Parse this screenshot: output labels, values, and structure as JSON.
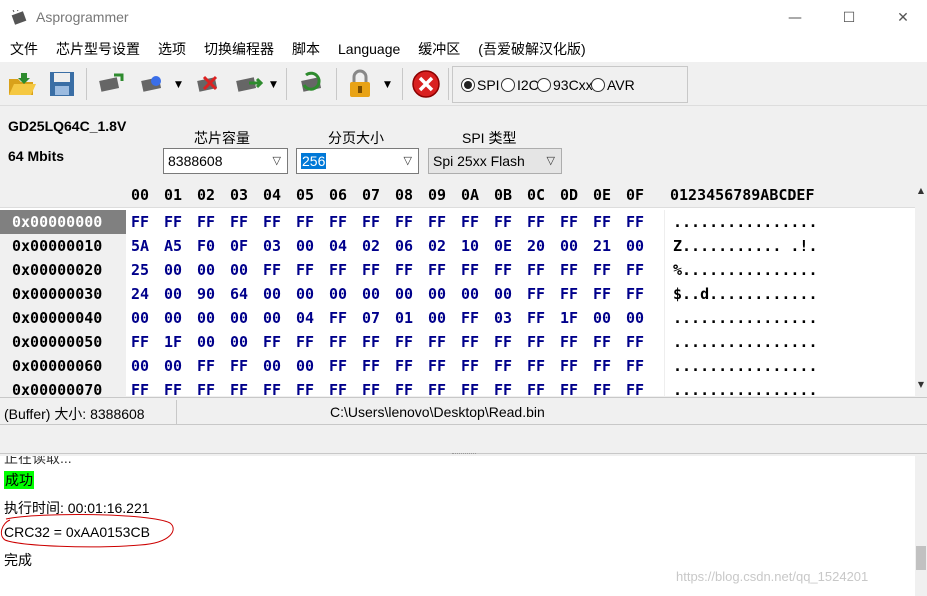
{
  "window": {
    "title": "Asprogrammer",
    "min_glyph": "—",
    "max_glyph": "☐",
    "close_glyph": "✕"
  },
  "menu": [
    "文件",
    "芯片型号设置",
    "选项",
    "切换编程器",
    "脚本",
    "Language",
    "缓冲区",
    "(吾爱破解汉化版)"
  ],
  "toolbar": {
    "icons": [
      "open-folder-icon",
      "save-icon",
      "read-chip-icon",
      "write-chip-icon",
      "erase-chip-icon",
      "verify-chip-icon",
      "auto-program-icon",
      "lock-icon",
      "stop-icon"
    ],
    "radios": [
      {
        "label": "SPI",
        "checked": true
      },
      {
        "label": "I2C",
        "checked": false
      },
      {
        "label": "93Cxx",
        "checked": false
      },
      {
        "label": "AVR",
        "checked": false
      }
    ]
  },
  "chip": {
    "name": "GD25LQ64C_1.8V",
    "size": "64 Mbits",
    "capacity_label": "芯片容量",
    "capacity_value": "8388608",
    "page_label": "分页大小",
    "page_value": "256",
    "spi_label": "SPI 类型",
    "spi_value": "Spi 25xx Flash"
  },
  "hex": {
    "columns": [
      "00",
      "01",
      "02",
      "03",
      "04",
      "05",
      "06",
      "07",
      "08",
      "09",
      "0A",
      "0B",
      "0C",
      "0D",
      "0E",
      "0F"
    ],
    "ascii_header": "0123456789ABCDEF",
    "rows": [
      {
        "addr": "0x00000000",
        "bytes": [
          "FF",
          "FF",
          "FF",
          "FF",
          "FF",
          "FF",
          "FF",
          "FF",
          "FF",
          "FF",
          "FF",
          "FF",
          "FF",
          "FF",
          "FF",
          "FF"
        ],
        "ascii": "................"
      },
      {
        "addr": "0x00000010",
        "bytes": [
          "5A",
          "A5",
          "F0",
          "0F",
          "03",
          "00",
          "04",
          "02",
          "06",
          "02",
          "10",
          "0E",
          "20",
          "00",
          "21",
          "00"
        ],
        "ascii": "Z........... .!."
      },
      {
        "addr": "0x00000020",
        "bytes": [
          "25",
          "00",
          "00",
          "00",
          "FF",
          "FF",
          "FF",
          "FF",
          "FF",
          "FF",
          "FF",
          "FF",
          "FF",
          "FF",
          "FF",
          "FF"
        ],
        "ascii": "%..............."
      },
      {
        "addr": "0x00000030",
        "bytes": [
          "24",
          "00",
          "90",
          "64",
          "00",
          "00",
          "00",
          "00",
          "00",
          "00",
          "00",
          "00",
          "FF",
          "FF",
          "FF",
          "FF"
        ],
        "ascii": "$..d............"
      },
      {
        "addr": "0x00000040",
        "bytes": [
          "00",
          "00",
          "00",
          "00",
          "00",
          "04",
          "FF",
          "07",
          "01",
          "00",
          "FF",
          "03",
          "FF",
          "1F",
          "00",
          "00"
        ],
        "ascii": "................"
      },
      {
        "addr": "0x00000050",
        "bytes": [
          "FF",
          "1F",
          "00",
          "00",
          "FF",
          "FF",
          "FF",
          "FF",
          "FF",
          "FF",
          "FF",
          "FF",
          "FF",
          "FF",
          "FF",
          "FF"
        ],
        "ascii": "................"
      },
      {
        "addr": "0x00000060",
        "bytes": [
          "00",
          "00",
          "FF",
          "FF",
          "00",
          "00",
          "FF",
          "FF",
          "FF",
          "FF",
          "FF",
          "FF",
          "FF",
          "FF",
          "FF",
          "FF"
        ],
        "ascii": "................"
      },
      {
        "addr": "0x00000070",
        "bytes": [
          "FF",
          "FF",
          "FF",
          "FF",
          "FF",
          "FF",
          "FF",
          "FF",
          "FF",
          "FF",
          "FF",
          "FF",
          "FF",
          "FF",
          "FF",
          "FF"
        ],
        "ascii": "................"
      }
    ]
  },
  "status": {
    "buffer": "(Buffer)  大小:   8388608",
    "path": "C:\\Users\\lenovo\\Desktop\\Read.bin"
  },
  "log": {
    "cut_line": "正在读取...",
    "success": "成功",
    "time": "执行时间:  00:01:16.221",
    "crc": "CRC32 = 0xAA0153CB",
    "done": "完成",
    "watermark": "https://blog.csdn.net/qq_1524201"
  },
  "colors": {
    "accent": "#0078d7",
    "success": "#00ff00",
    "hex_bytes": "#00008b",
    "annotation": "#cc0000"
  }
}
